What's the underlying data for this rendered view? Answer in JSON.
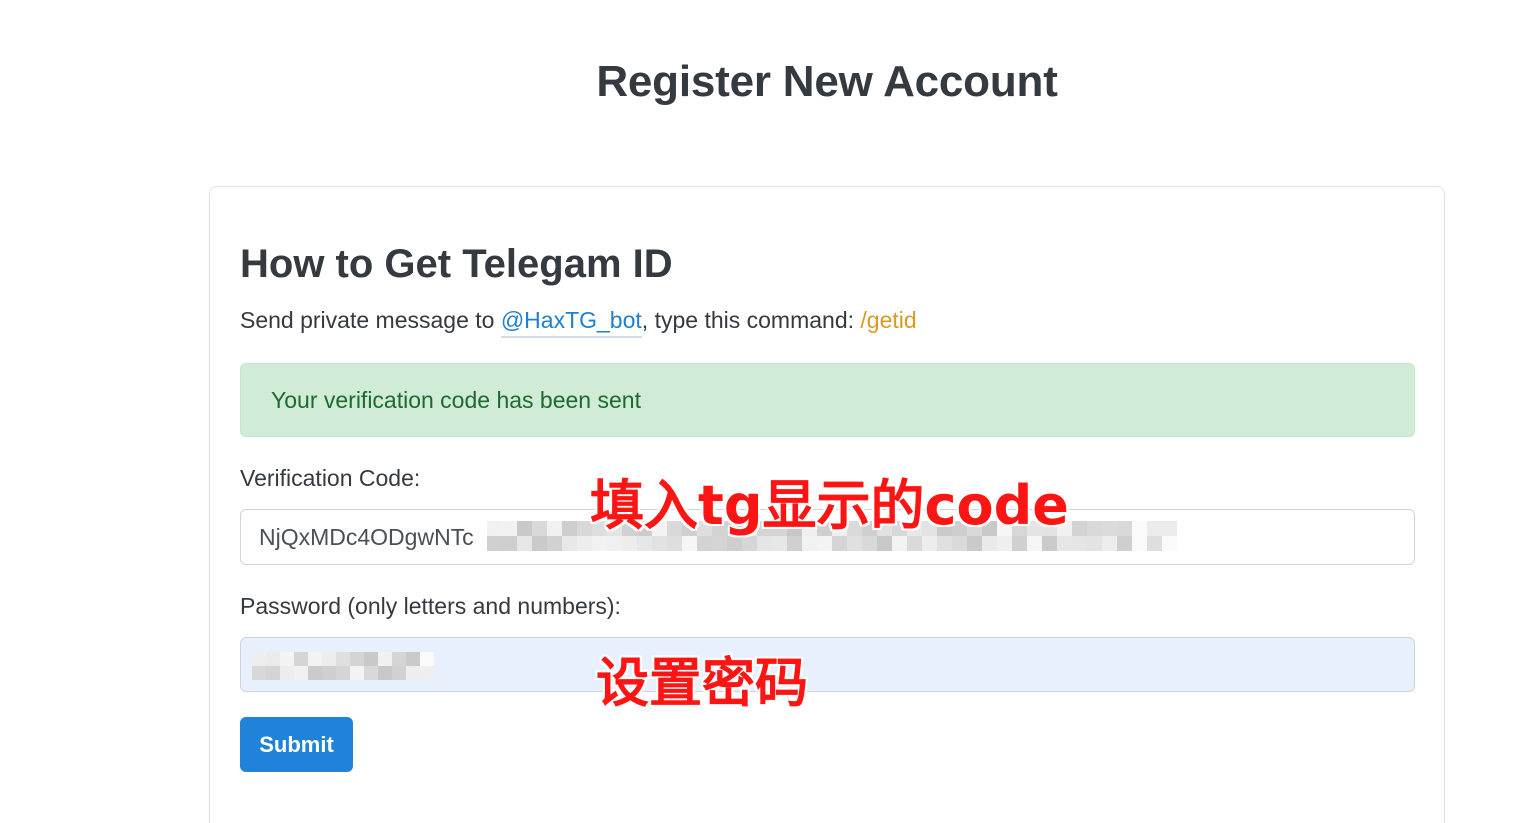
{
  "page": {
    "title": "Register New Account"
  },
  "card": {
    "heading": "How to Get Telegam ID",
    "instruction": {
      "prefix": "Send private message to ",
      "bot_link": "@HaxTG_bot",
      "middle": ", type this command: ",
      "command": "/getid"
    },
    "alert": {
      "message": "Your verification code has been sent"
    },
    "verification_field": {
      "label": "Verification Code:",
      "value": "NjQxMDc4ODgwNTc"
    },
    "password_field": {
      "label": "Password (only letters and numbers):"
    },
    "submit_button": {
      "label": "Submit"
    }
  },
  "annotations": {
    "code_hint": "填入tg显示的code",
    "password_hint": "设置密码"
  },
  "colors": {
    "text": "#343a40",
    "link": "#1f7fd2",
    "command": "#d99a22",
    "alert_bg": "#d1ecd6",
    "alert_text": "#1d6a31",
    "primary_button": "#1e83d9",
    "autofill_bg": "#e8f0fe",
    "annotation": "#ff1414"
  }
}
